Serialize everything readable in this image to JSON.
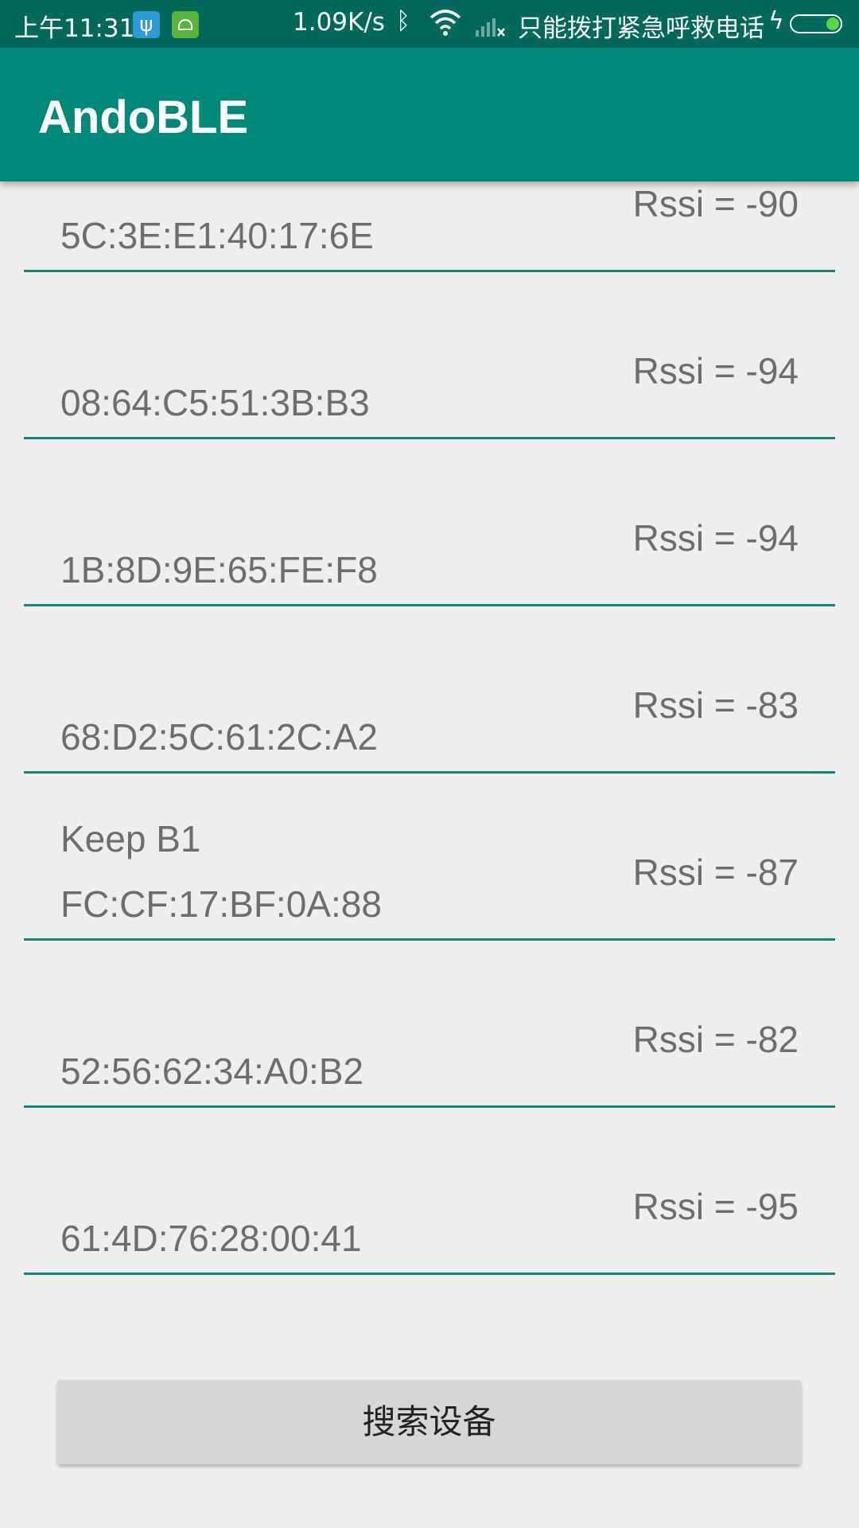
{
  "status_bar": {
    "time": "上午11:31",
    "usb_icon": "usb-icon",
    "android_icon": "android-debug-icon",
    "net_speed": "1.09K/s",
    "bt_icon": "bluetooth-icon",
    "wifi_icon": "wifi-icon",
    "signal_icon": "no-signal-icon",
    "carrier": "只能拨打紧急呼救电话",
    "charge_icon": "charging-icon",
    "battery_icon": "battery-icon"
  },
  "app_bar": {
    "title": "AndoBLE"
  },
  "devices": [
    {
      "name": "",
      "mac": "5C:3E:E1:40:17:6E",
      "rssi": "Rssi = -90"
    },
    {
      "name": "",
      "mac": "08:64:C5:51:3B:B3",
      "rssi": "Rssi = -94"
    },
    {
      "name": "",
      "mac": "1B:8D:9E:65:FE:F8",
      "rssi": "Rssi = -94"
    },
    {
      "name": "",
      "mac": "68:D2:5C:61:2C:A2",
      "rssi": "Rssi = -83"
    },
    {
      "name": "Keep B1",
      "mac": "FC:CF:17:BF:0A:88",
      "rssi": "Rssi = -87"
    },
    {
      "name": "",
      "mac": "52:56:62:34:A0:B2",
      "rssi": "Rssi = -82"
    },
    {
      "name": "",
      "mac": "61:4D:76:28:00:41",
      "rssi": "Rssi = -95"
    }
  ],
  "search_button": {
    "label": "搜索设备"
  },
  "colors": {
    "status_bar": "#00695c",
    "app_bar": "#00897b",
    "divider": "#12857a",
    "background": "#eeeeee",
    "button": "#d6d6d6"
  }
}
